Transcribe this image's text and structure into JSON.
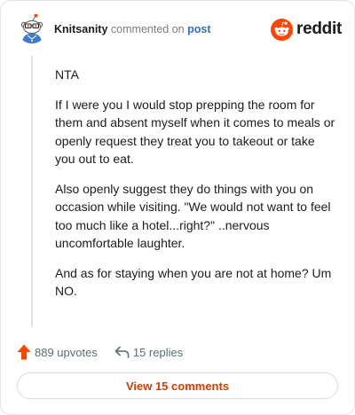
{
  "comment": {
    "username": "Knitsanity",
    "action_text": "commented on",
    "post_link": "post",
    "avatar_icon": "snoo-avatar-icon",
    "paragraphs": [
      "NTA",
      "If I were you I would stop prepping the room for them and absent myself when it comes to meals or openly request they treat you to takeout or take you out to eat.",
      "Also openly suggest they do things with you on occasion while visiting. \"We would not want to feel too much like a hotel...right?\" ..nervous uncomfortable laughter.",
      "And as for staying when you are not at home? Um NO."
    ]
  },
  "brand": {
    "name": "reddit",
    "icon": "reddit-logo-icon",
    "color": "#ff4500"
  },
  "actions": {
    "upvotes": "889 upvotes",
    "upvote_icon": "upvote-arrow-icon",
    "upvote_color": "#ff4500",
    "replies": "15 replies",
    "reply_icon": "reply-arrow-icon"
  },
  "footer": {
    "view_comments": "View 15 comments",
    "accent": "#d93a00"
  }
}
